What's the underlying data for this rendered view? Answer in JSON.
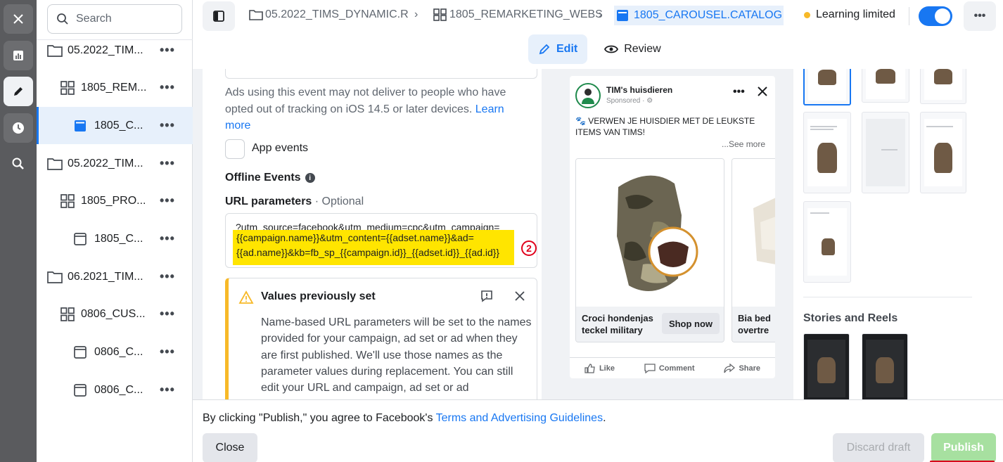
{
  "rail": {
    "items": [
      {
        "name": "close-icon"
      },
      {
        "name": "chart-icon"
      },
      {
        "name": "edit-icon"
      },
      {
        "name": "clock-icon"
      },
      {
        "name": "zoom-icon"
      }
    ]
  },
  "tree": {
    "search_placeholder": "Search",
    "items": [
      {
        "label": "05.2022_TIM...",
        "type": "folder"
      },
      {
        "label": "1805_REM...",
        "type": "adset"
      },
      {
        "label": "1805_C...",
        "type": "ad",
        "selected": true
      },
      {
        "label": "05.2022_TIM...",
        "type": "folder"
      },
      {
        "label": "1805_PRO...",
        "type": "adset"
      },
      {
        "label": "1805_C...",
        "type": "ad"
      },
      {
        "label": "06.2021_TIM...",
        "type": "folder"
      },
      {
        "label": "0806_CUS...",
        "type": "adset"
      },
      {
        "label": "0806_C...",
        "type": "ad"
      },
      {
        "label": "0806_C...",
        "type": "ad"
      }
    ],
    "more": "•••"
  },
  "header": {
    "breadcrumbs": [
      "05.2022_TIMS_DYNAMIC.R",
      "1805_REMARKETING_WEBS",
      "1805_CAROUSEL.CATALOG"
    ],
    "status": "Learning limited",
    "status_color": "#f7b928",
    "more": "•••"
  },
  "tabs": {
    "edit": "Edit",
    "review": "Review"
  },
  "form": {
    "tracking_note": "Ads using this event may not deliver to people who have opted out of tracking on iOS 14.5 or later devices.",
    "learn_more": "Learn more",
    "app_events": "App events",
    "offline_events": "Offline Events",
    "url_params_label": "URL parameters",
    "url_params_optional": "· Optional",
    "url_line1": "?utm_source=facebook&utm_medium=cpc&utm_campaign=",
    "url_line2": "{{campaign.name}}&utm_content={{adset.name}}&ad=",
    "url_line3": "{{ad.name}}&kb=fb_sp_{{campaign.id}}_{{adset.id}}_{{ad.id}}",
    "annotation_number": "2",
    "warning_title": "Values previously set",
    "warning_body": "Name-based URL parameters will be set to the names provided for your campaign, ad set or ad when they are first published. We'll use those names as the parameter values during replacement. You can still edit your URL and campaign, ad set or ad"
  },
  "preview": {
    "page_name": "TIM's huisdieren",
    "sponsored": "Sponsored",
    "post_text": "🐾 VERWEN JE HUISDIER MET DE LEUKSTE ITEMS VAN TIMS!",
    "see_more": "...See more",
    "card1_title": "Croci hondenjas teckel military",
    "card1_cta": "Shop now",
    "card2_title": "Bia bed overtre",
    "like": "Like",
    "comment": "Comment",
    "share": "Share"
  },
  "placements": {
    "stories_heading": "Stories and Reels"
  },
  "footer": {
    "terms_prefix": "By clicking \"Publish,\" you agree to Facebook's ",
    "terms_link": "Terms and Advertising Guidelines",
    "terms_suffix": ".",
    "close": "Close",
    "discard": "Discard draft",
    "publish": "Publish"
  },
  "colors": {
    "accent": "#1877f2",
    "highlight": "#ffe500",
    "annotation_red": "#e0001b",
    "publish_green": "#a7e0a0"
  }
}
